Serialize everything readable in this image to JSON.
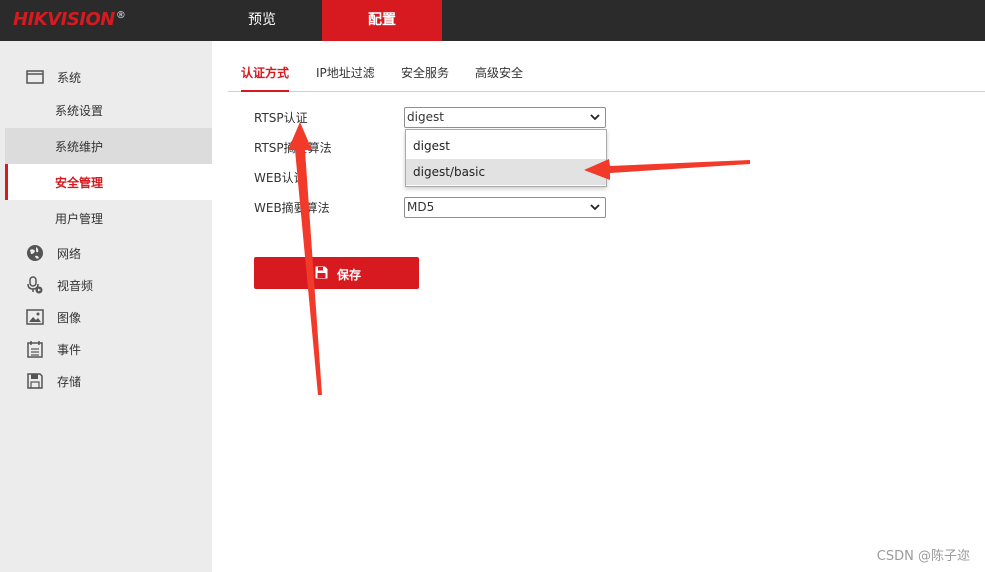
{
  "brand": {
    "name": "HIKVISION",
    "mark": "®",
    "accent_color": "#d71920"
  },
  "topnav": {
    "preview": "预览",
    "config": "配置"
  },
  "sidebar": {
    "system": {
      "label": "系统",
      "icon": "window-icon"
    },
    "system_items": [
      "系统设置",
      "系统维护",
      "安全管理",
      "用户管理"
    ],
    "groups": [
      {
        "label": "网络",
        "icon": "globe-icon"
      },
      {
        "label": "视音频",
        "icon": "microphone-icon"
      },
      {
        "label": "图像",
        "icon": "image-icon"
      },
      {
        "label": "事件",
        "icon": "calendar-icon"
      },
      {
        "label": "存储",
        "icon": "floppy-icon"
      }
    ]
  },
  "tabs": [
    "认证方式",
    "IP地址过滤",
    "安全服务",
    "高级安全"
  ],
  "form": {
    "rtsp_auth": {
      "label": "RTSP认证",
      "value": "digest"
    },
    "rtsp_digest": {
      "label": "RTSP摘要算法"
    },
    "web_auth": {
      "label": "WEB认证"
    },
    "web_digest": {
      "label": "WEB摘要算法",
      "value": "MD5"
    },
    "dropdown_options": [
      "digest",
      "digest/basic"
    ]
  },
  "save_label": "保存",
  "watermark": "CSDN @陈子迩"
}
